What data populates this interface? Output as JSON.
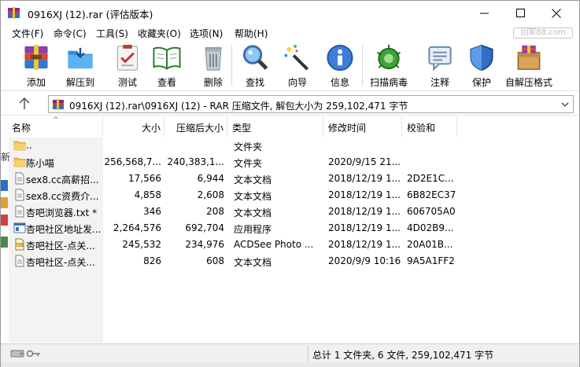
{
  "window": {
    "title": "0916XJ (12).rar (评估版本)",
    "controls": {
      "minimize": "minimize",
      "maximize": "maximize",
      "close": "close"
    }
  },
  "menu": {
    "items": [
      "文件(F)",
      "命令(C)",
      "工具(S)",
      "收藏夹(O)",
      "选项(N)",
      "帮助(H)"
    ],
    "watermark": "回家88.com"
  },
  "toolbar": {
    "buttons": [
      {
        "label": "添加",
        "icon": "add-archive-icon"
      },
      {
        "label": "解压到",
        "icon": "extract-to-icon"
      },
      {
        "label": "测试",
        "icon": "test-icon"
      },
      {
        "label": "查看",
        "icon": "view-book-icon"
      },
      {
        "label": "删除",
        "icon": "trash-icon"
      },
      {
        "label": "查找",
        "icon": "find-magnifier-icon"
      },
      {
        "label": "向导",
        "icon": "wizard-wand-icon"
      },
      {
        "label": "信息",
        "icon": "info-icon"
      },
      {
        "label": "扫描病毒",
        "icon": "virus-scan-icon"
      },
      {
        "label": "注释",
        "icon": "comment-icon"
      },
      {
        "label": "保护",
        "icon": "shield-icon"
      },
      {
        "label": "自解压格式",
        "icon": "sfx-box-icon"
      }
    ]
  },
  "pathbar": {
    "path": "0916XJ (12).rar\\0916XJ (12) - RAR 压缩文件, 解包大小为 259,102,471 字节"
  },
  "columns": {
    "name": "名称",
    "size": "大小",
    "packed": "压缩后大小",
    "type": "类型",
    "modified": "修改时间",
    "crc": "校验和"
  },
  "files": [
    {
      "name": "..",
      "size": "",
      "packed": "",
      "type": "文件夹",
      "modified": "",
      "crc": "",
      "icon": "folder-icon"
    },
    {
      "name": "陈小喵",
      "size": "256,568,7...",
      "packed": "240,383,1...",
      "type": "文件夹",
      "modified": "2020/9/15 21...",
      "crc": "",
      "icon": "folder-icon"
    },
    {
      "name": "sex8.cc高薪招...",
      "size": "17,566",
      "packed": "6,944",
      "type": "文本文档",
      "modified": "2018/12/19 1...",
      "crc": "2D2E1C...",
      "icon": "text-file-icon"
    },
    {
      "name": "sex8.cc资费介...",
      "size": "4,858",
      "packed": "2,608",
      "type": "文本文档",
      "modified": "2018/12/19 1...",
      "crc": "6B82EC37",
      "icon": "text-file-icon"
    },
    {
      "name": "杏吧浏览器.txt *",
      "size": "346",
      "packed": "208",
      "type": "文本文档",
      "modified": "2018/12/19 1...",
      "crc": "606705A0",
      "icon": "text-file-icon"
    },
    {
      "name": "杏吧社区地址发...",
      "size": "2,264,576",
      "packed": "692,704",
      "type": "应用程序",
      "modified": "2018/12/19 1...",
      "crc": "4D02B9...",
      "icon": "exe-file-icon"
    },
    {
      "name": "杏吧社区-点关...",
      "size": "245,532",
      "packed": "234,976",
      "type": "ACDSee Photo ...",
      "modified": "2018/12/19 1...",
      "crc": "20A01B...",
      "icon": "jpg-file-icon"
    },
    {
      "name": "杏吧社区-点关...",
      "size": "826",
      "packed": "608",
      "type": "文本文档",
      "modified": "2020/9/9 10:16",
      "crc": "9A5A1FF2",
      "icon": "text-file-icon"
    }
  ],
  "status": {
    "summary": "总计 1 文件夹, 6 文件, 259,102,471 字节"
  }
}
